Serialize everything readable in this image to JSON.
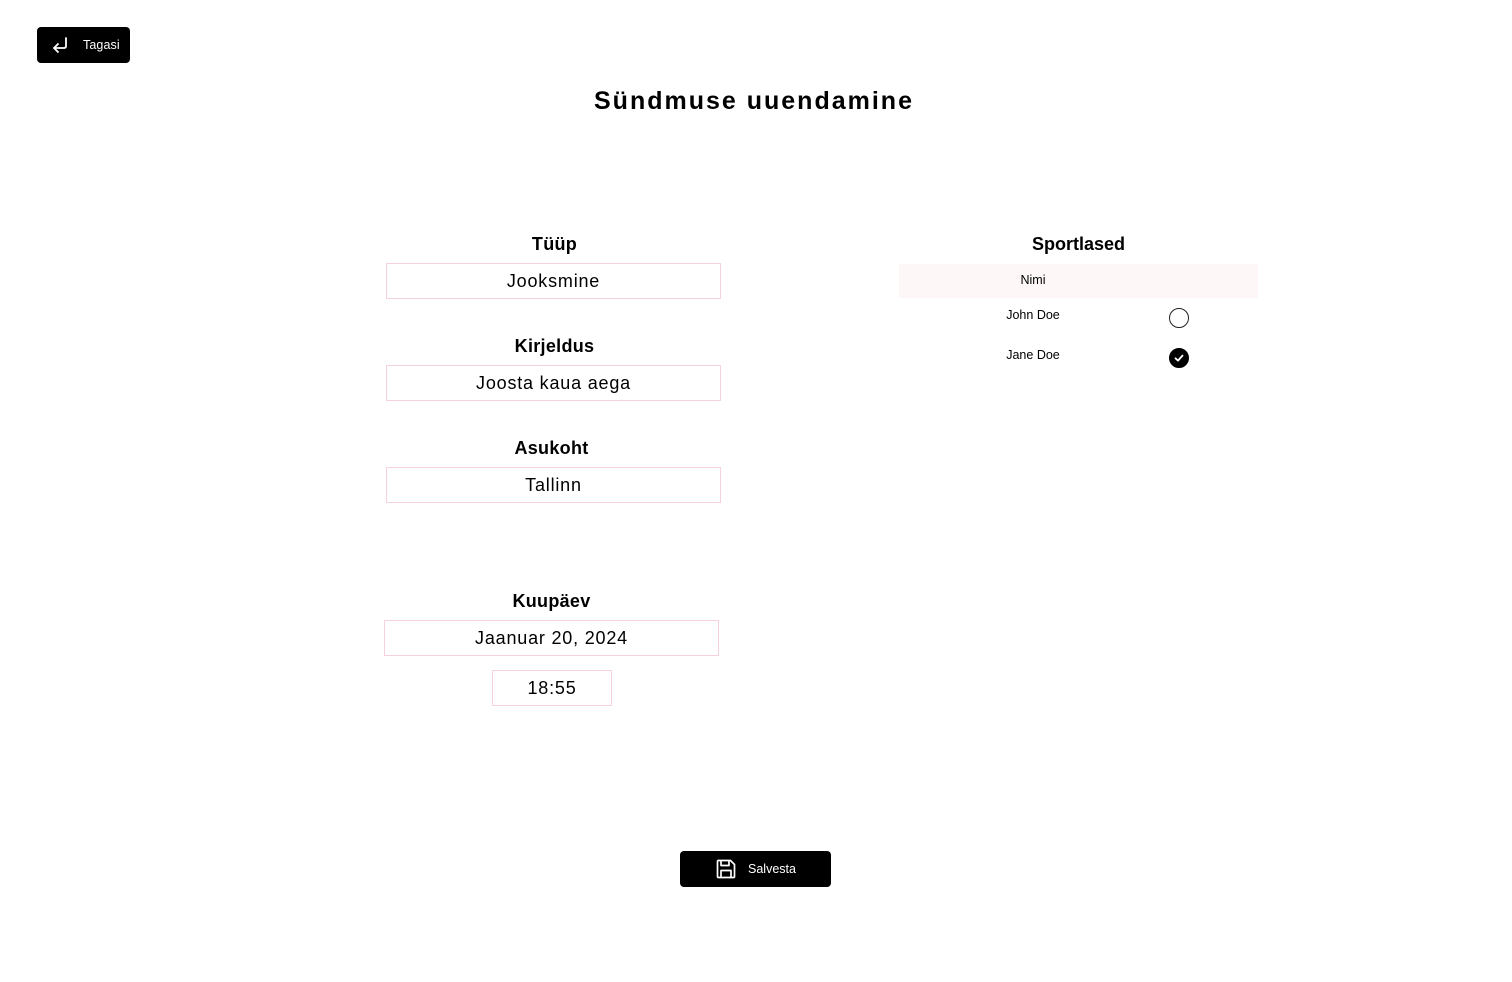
{
  "header": {
    "back_label": "Tagasi",
    "back_icon": "return-arrow-icon",
    "title": "Sündmuse uuendamine"
  },
  "form": {
    "type": {
      "label": "Tüüp",
      "value": "Jooksmine"
    },
    "description": {
      "label": "Kirjeldus",
      "value": "Joosta kaua aega"
    },
    "location": {
      "label": "Asukoht",
      "value": "Tallinn"
    },
    "date": {
      "label": "Kuupäev",
      "value": "Jaanuar 20, 2024"
    },
    "time": {
      "value": "18:55"
    }
  },
  "athletes": {
    "title": "Sportlased",
    "column_name": "Nimi",
    "rows": [
      {
        "name": "John Doe",
        "selected": false
      },
      {
        "name": "Jane Doe",
        "selected": true
      }
    ]
  },
  "footer": {
    "save_label": "Salvesta",
    "save_icon": "floppy-disk-icon"
  },
  "colors": {
    "button_bg": "#000000",
    "button_text": "#ffffff",
    "input_border": "#f6d3dc",
    "table_header_bg": "#fdf8f7"
  }
}
